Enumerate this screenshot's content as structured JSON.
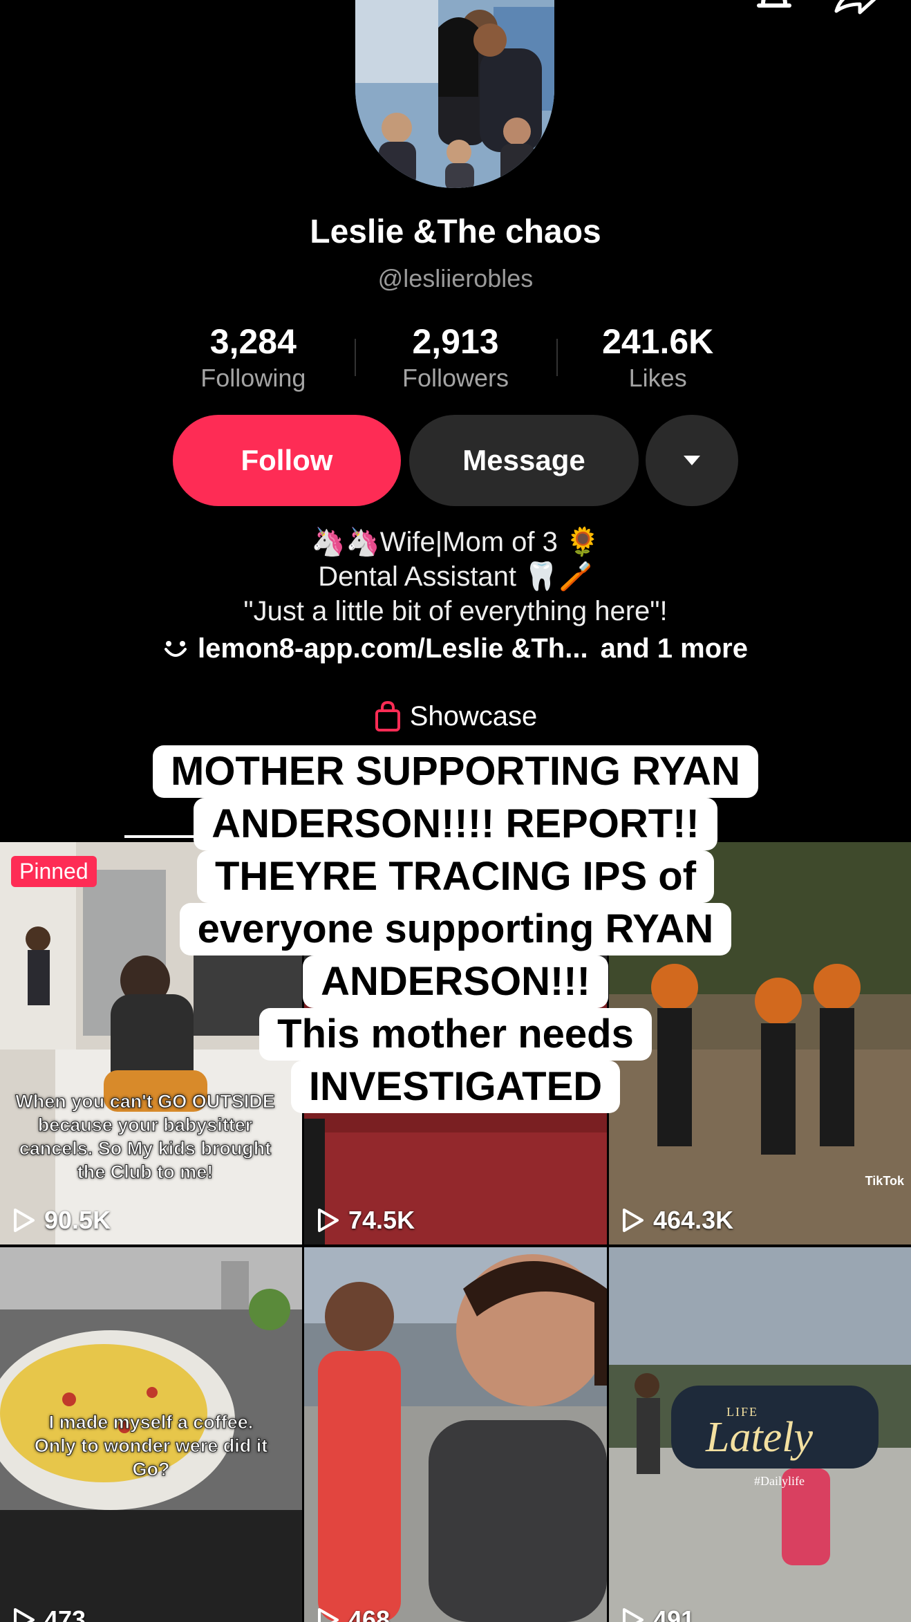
{
  "profile": {
    "name": "Leslie &The chaos",
    "handle": "@lesliierobles",
    "stats": [
      {
        "value": "3,284",
        "label": "Following"
      },
      {
        "value": "2,913",
        "label": "Followers"
      },
      {
        "value": "241.6K",
        "label": "Likes"
      }
    ],
    "follow_label": "Follow",
    "message_label": "Message",
    "bio": [
      "🦄🦄Wife|Mom of 3 🌻",
      "Dental Assistant 🦷🪥",
      "\"Just a little bit of everything here\"!"
    ],
    "link_text": "lemon8-app.com/Leslie &Th...",
    "link_more": "and 1 more",
    "showcase_label": "Showcase"
  },
  "overlay_text": [
    "MOTHER SUPPORTING RYAN",
    "ANDERSON!!!! REPORT!!",
    "THEYRE TRACING IPS of",
    "everyone supporting RYAN",
    "ANDERSON!!!",
    "This mother needs",
    "INVESTIGATED"
  ],
  "videos": [
    {
      "views": "90.5K",
      "pinned_label": "Pinned",
      "caption": [
        "When you can't GO OUTSIDE",
        "because your babysitter",
        "cancels. So My kids brought",
        "the Club to me!"
      ]
    },
    {
      "views": "74.5K"
    },
    {
      "views": "464.3K",
      "watermark": "TikTok"
    },
    {
      "views": "473",
      "caption": [
        "I made myself a coffee.",
        "Only to wonder were did it",
        "Go?"
      ]
    },
    {
      "views": "468"
    },
    {
      "views": "491",
      "title_big": "Lately",
      "title_small": "LIFE",
      "subtitle": "#Dailylife"
    }
  ],
  "colors": {
    "accent": "#fe2c55",
    "button_dark": "#2a2a2a",
    "background": "#000000"
  }
}
